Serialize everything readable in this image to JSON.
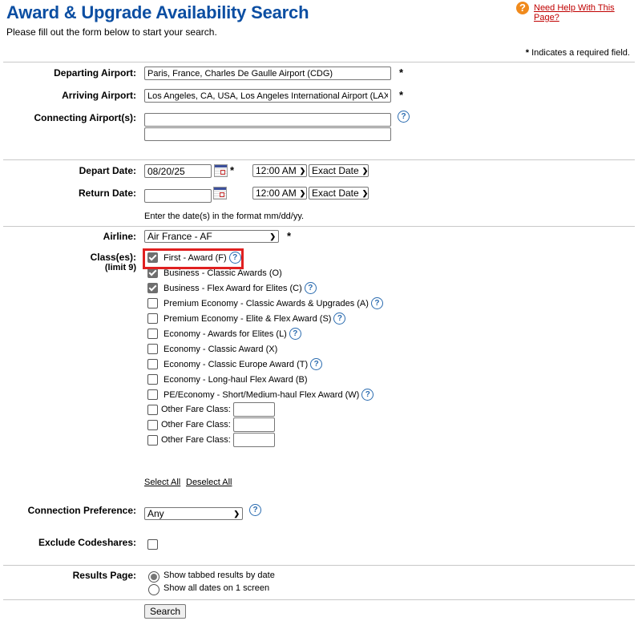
{
  "header": {
    "title": "Award & Upgrade Availability Search",
    "subtitle": "Please fill out the form below to start your search.",
    "help_link": "Need Help With This Page?",
    "required_note": "Indicates a required field.",
    "required_mark": "*"
  },
  "colors": {
    "title": "#0b4ea2",
    "help_link": "#c00000",
    "highlight_box": "#e02020",
    "help_icon": "#2b6cb0"
  },
  "airports": {
    "departing": {
      "label": "Departing Airport:",
      "value": "Paris, France, Charles De Gaulle Airport (CDG)"
    },
    "arriving": {
      "label": "Arriving Airport:",
      "value": "Los Angeles, CA, USA, Los Angeles International Airport (LAX)"
    },
    "connecting": {
      "label": "Connecting Airport(s):",
      "value1": "",
      "value2": ""
    }
  },
  "dates": {
    "depart": {
      "label": "Depart Date:",
      "value": "08/20/25",
      "time": "12:00 AM",
      "flex": "Exact Date"
    },
    "return": {
      "label": "Return Date:",
      "value": "",
      "time": "12:00 AM",
      "flex": "Exact Date"
    },
    "format_note": "Enter the date(s) in the format mm/dd/yy."
  },
  "airline": {
    "label": "Airline:",
    "value": "Air France - AF"
  },
  "classes": {
    "label": "Class(es):",
    "limit": "(limit 9)",
    "items": [
      {
        "label": "First - Award (F)",
        "checked": true,
        "help": true,
        "highlighted": true
      },
      {
        "label": "Business - Classic Awards (O)",
        "checked": true,
        "help": false
      },
      {
        "label": "Business - Flex Award for Elites (C)",
        "checked": true,
        "help": true
      },
      {
        "label": "Premium Economy - Classic Awards & Upgrades (A)",
        "checked": false,
        "help": true
      },
      {
        "label": "Premium Economy - Elite & Flex Award (S)",
        "checked": false,
        "help": true
      },
      {
        "label": "Economy - Awards for Elites (L)",
        "checked": false,
        "help": true
      },
      {
        "label": "Economy - Classic Award (X)",
        "checked": false,
        "help": false
      },
      {
        "label": "Economy - Classic Europe Award (T)",
        "checked": false,
        "help": true
      },
      {
        "label": "Economy - Long-haul Flex Award (B)",
        "checked": false,
        "help": false
      },
      {
        "label": "PE/Economy - Short/Medium-haul Flex Award (W)",
        "checked": false,
        "help": true
      }
    ],
    "other": [
      {
        "label": "Other Fare Class:",
        "value": ""
      },
      {
        "label": "Other Fare Class:",
        "value": ""
      },
      {
        "label": "Other Fare Class:",
        "value": ""
      }
    ],
    "select_all": "Select All",
    "deselect_all": "Deselect All"
  },
  "connection": {
    "label": "Connection Preference:",
    "value": "Any"
  },
  "codeshares": {
    "label": "Exclude Codeshares:",
    "checked": false
  },
  "results": {
    "label": "Results Page:",
    "options": [
      {
        "label": "Show tabbed results by date",
        "selected": true
      },
      {
        "label": "Show all dates on 1 screen",
        "selected": false
      }
    ]
  },
  "search_button": "Search"
}
